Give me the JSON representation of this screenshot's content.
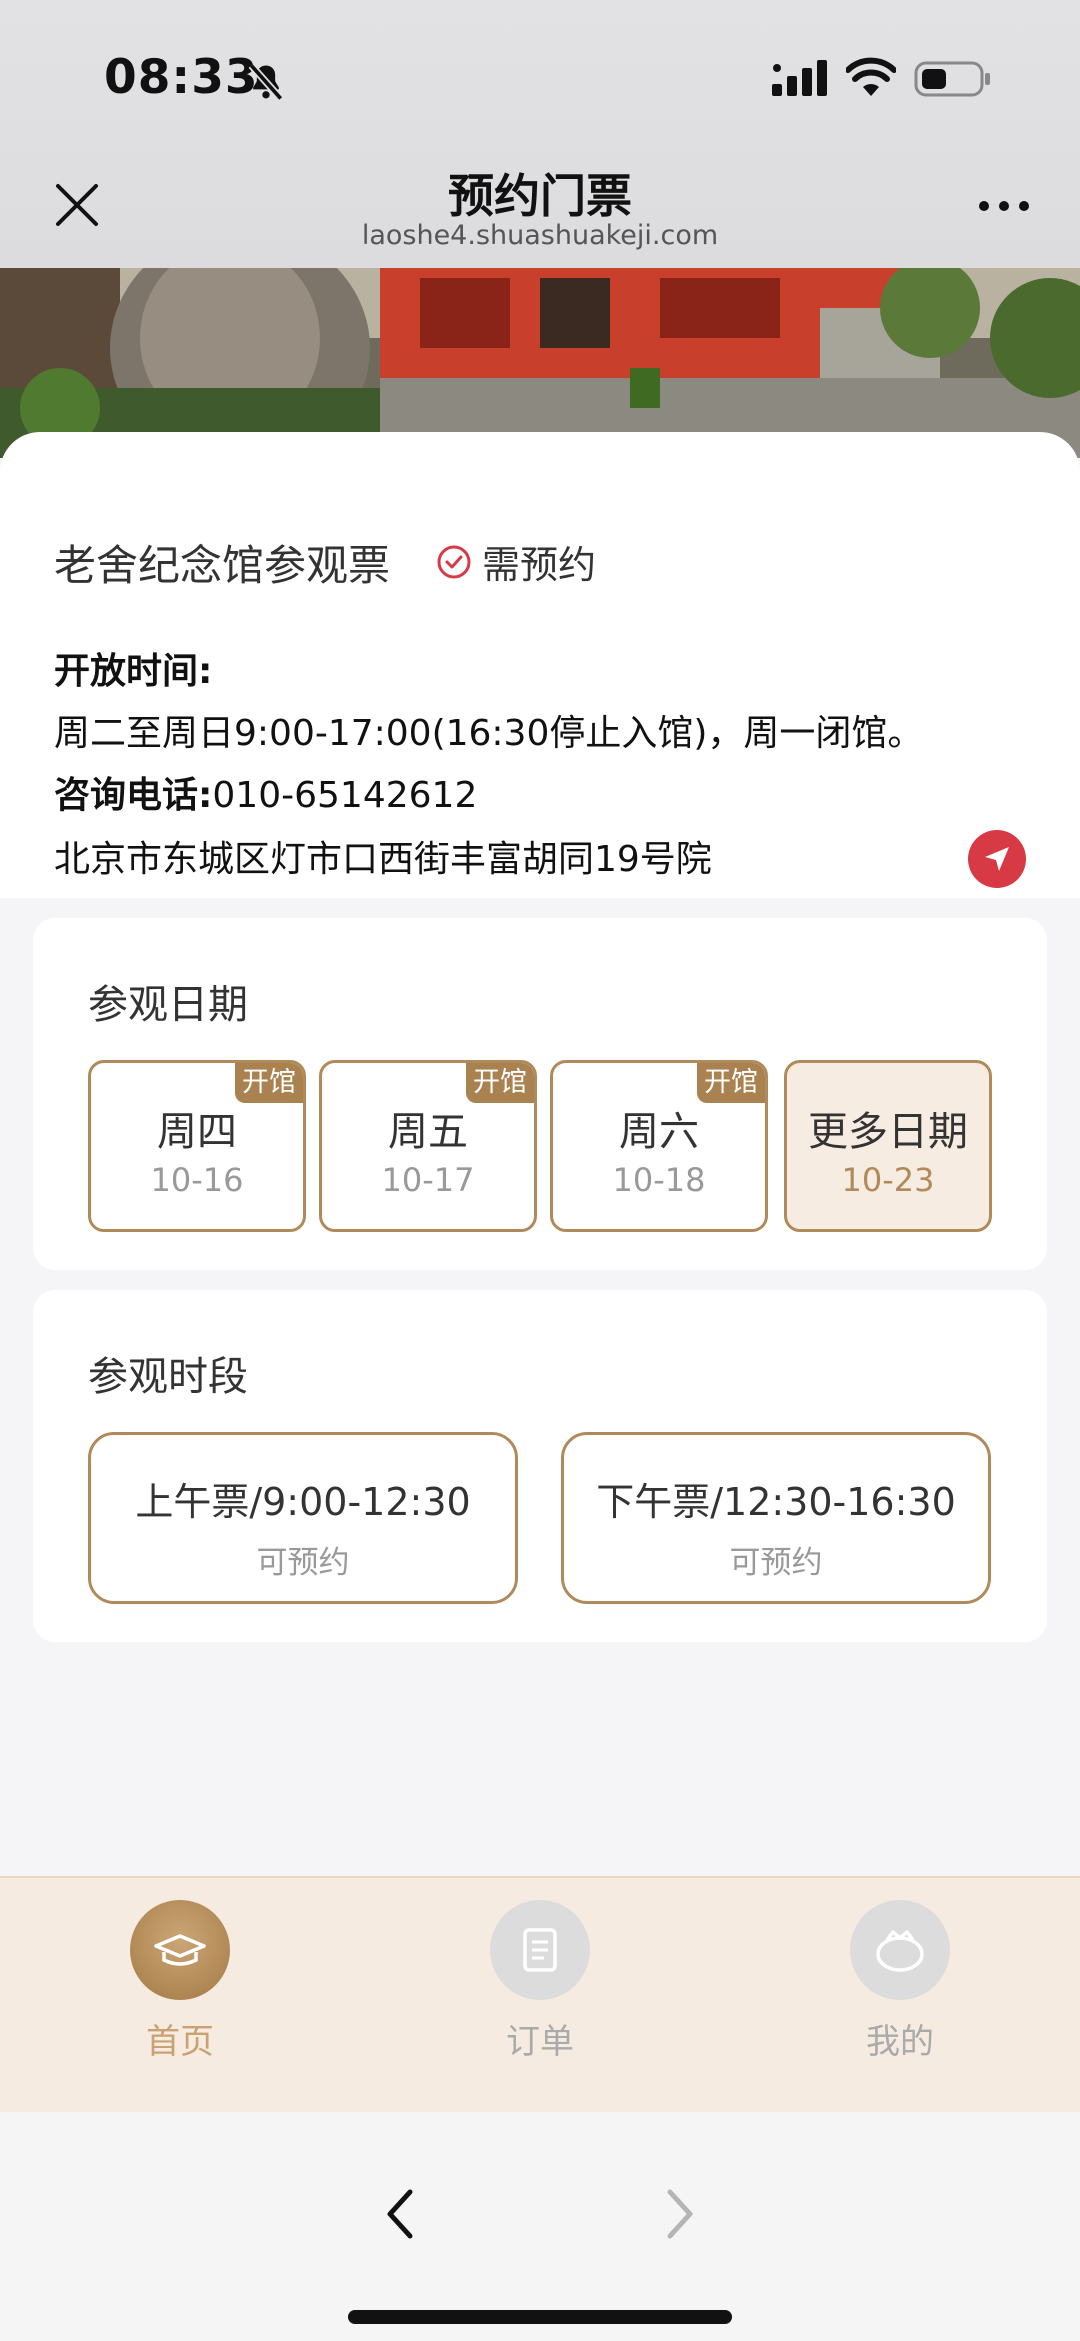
{
  "status_bar": {
    "time": "08:33"
  },
  "header": {
    "title": "预约门票",
    "url": "laoshe4.shuashuakeji.com"
  },
  "info": {
    "ticket_name": "老舍纪念馆参观票",
    "reserve_badge": "需预约",
    "open_hours_label": "开放时间:",
    "open_hours": "周二至周日9:00-17:00(16:30停止入馆)，周一闭馆。",
    "phone_label": "咨询电话:",
    "phone": "010-65142612",
    "address": "北京市东城区灯市口西街丰富胡同19号院"
  },
  "visit_date": {
    "title": "参观日期",
    "dates": [
      {
        "tag": "开馆",
        "day": "周四",
        "date": "10-16"
      },
      {
        "tag": "开馆",
        "day": "周五",
        "date": "10-17"
      },
      {
        "tag": "开馆",
        "day": "周六",
        "date": "10-18"
      }
    ],
    "more": {
      "label": "更多日期",
      "date": "10-23"
    }
  },
  "visit_slot": {
    "title": "参观时段",
    "slots": [
      {
        "label": "上午票/9:00-12:30",
        "status": "可预约"
      },
      {
        "label": "下午票/12:30-16:30",
        "status": "可预约"
      }
    ]
  },
  "tabbar": {
    "items": [
      {
        "label": "首页",
        "icon": "home-icon",
        "active": true
      },
      {
        "label": "订单",
        "icon": "order-icon",
        "active": false
      },
      {
        "label": "我的",
        "icon": "profile-icon",
        "active": false
      }
    ]
  },
  "colors": {
    "accent": "#b08a5a",
    "tag": "#a9824f",
    "danger": "#d83a45",
    "tab_bg": "#f6ebe0"
  }
}
